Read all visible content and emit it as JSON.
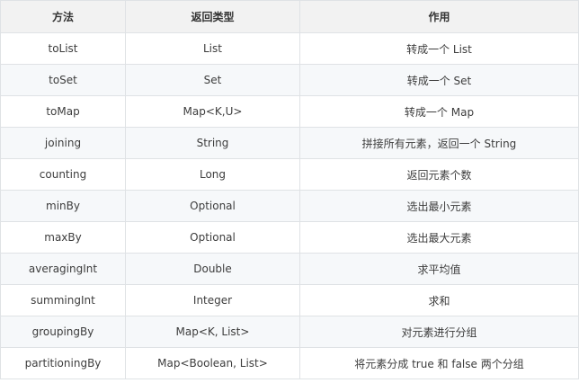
{
  "table": {
    "headers": [
      "方法",
      "返回类型",
      "作用"
    ],
    "rows": [
      [
        "toList",
        "List",
        "转成一个 List"
      ],
      [
        "toSet",
        "Set",
        "转成一个 Set"
      ],
      [
        "toMap",
        "Map<K,U>",
        "转成一个 Map"
      ],
      [
        "joining",
        "String",
        "拼接所有元素，返回一个 String"
      ],
      [
        "counting",
        "Long",
        "返回元素个数"
      ],
      [
        "minBy",
        "Optional",
        "选出最小元素"
      ],
      [
        "maxBy",
        "Optional",
        "选出最大元素"
      ],
      [
        "averagingInt",
        "Double",
        "求平均值"
      ],
      [
        "summingInt",
        "Integer",
        "求和"
      ],
      [
        "groupingBy",
        "Map<K, List>",
        "对元素进行分组"
      ],
      [
        "partitioningBy",
        "Map<Boolean, List>",
        "将元素分成 true 和 false 两个分组"
      ]
    ]
  }
}
